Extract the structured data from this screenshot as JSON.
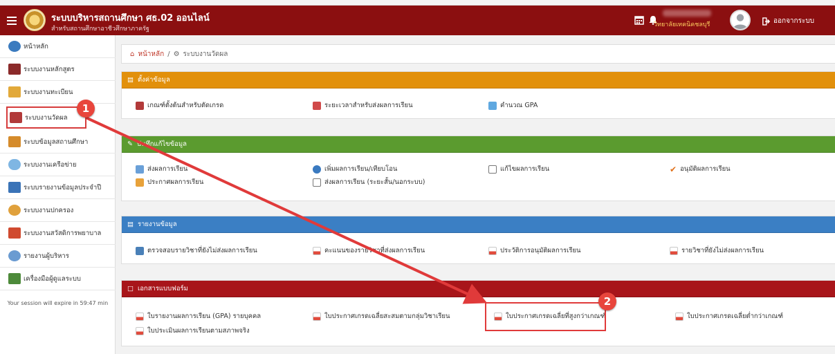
{
  "header": {
    "app_title": "ระบบบริหารสถานศึกษา ศธ.02 ออนไลน์",
    "app_subtitle": "สำหรับสถานศึกษาอาชีวศึกษาภาครัฐ",
    "school": "วิทยาลัยเทคนิคชลบุรี",
    "logout_label": "ออกจากระบบ",
    "icons": [
      "menu-icon",
      "calendar-icon",
      "bell-icon",
      "user-avatar",
      "logout-icon"
    ]
  },
  "sidebar": {
    "items": [
      {
        "label": "หน้าหลัก",
        "icon": "home-icon",
        "color": "#3b7bbf"
      },
      {
        "label": "ระบบงานหลักสูตร",
        "icon": "book-icon",
        "color": "#8b2a2a"
      },
      {
        "label": "ระบบงานทะเบียน",
        "icon": "people-icon",
        "color": "#e2a93a"
      },
      {
        "label": "ระบบงานวัดผล",
        "icon": "calendar-icon",
        "color": "#b23a3a"
      },
      {
        "label": "ระบบข้อมูลสถานศึกษา",
        "icon": "school-icon",
        "color": "#d58b2b"
      },
      {
        "label": "ระบบงานเครือข่าย",
        "icon": "cloud-icon",
        "color": "#7fb6e3"
      },
      {
        "label": "ระบบรายงานข้อมูลประจำปี",
        "icon": "report-icon",
        "color": "#3a73b7"
      },
      {
        "label": "ระบบงานปกครอง",
        "icon": "person-icon",
        "color": "#e0a13c"
      },
      {
        "label": "ระบบงานสวัสดิการพยาบาล",
        "icon": "firstaid-icon",
        "color": "#d04a2f"
      },
      {
        "label": "รายงานผู้บริหาร",
        "icon": "executive-icon",
        "color": "#6a9bd1"
      },
      {
        "label": "เครื่องมือผู้ดูแลระบบ",
        "icon": "admin-icon",
        "color": "#4d8a3a"
      }
    ],
    "session_text": "Your session will expire in 59:47 min"
  },
  "breadcrumb": {
    "home": "หน้าหลัก",
    "separator": "/",
    "current": "ระบบงานวัดผล"
  },
  "panels": [
    {
      "title": "ตั้งค่าข้อมูล",
      "color": "#e2900b",
      "links": [
        "เกณฑ์ตั้งต้นสำหรับตัดเกรด",
        "ระยะเวลาสำหรับส่งผลการเรียน",
        "คำนวณ GPA"
      ]
    },
    {
      "title": "บันทึกแก้ไขข้อมูล",
      "color": "#5b9b2f",
      "links": [
        "ส่งผลการเรียน",
        "เพิ่มผลการเรียน/เทียบโอน",
        "แก้ไขผลการเรียน",
        "อนุมัติผลการเรียน",
        "ประกาศผลการเรียน",
        "ส่งผลการเรียน (ระยะสั้น/นอกระบบ)"
      ]
    },
    {
      "title": "รายงานข้อมูล",
      "color": "#3b7fc4",
      "links": [
        "ตรวจสอบรายวิชาที่ยังไม่ส่งผลการเรียน",
        "คะแนนของรายวิชาที่ส่งผลการเรียน",
        "ประวัติการอนุมัติผลการเรียน",
        "รายวิชาที่ยังไม่ส่งผลการเรียน"
      ]
    },
    {
      "title": "เอกสารแบบฟอร์ม",
      "color": "#a8151a",
      "links": [
        "ใบรายงานผลการเรียน (GPA) รายบุคคล",
        "ใบประกาศเกรดเฉลี่ยสะสมตามกลุ่มวิชาเรียน",
        "ใบประกาศเกรดเฉลี่ยที่สูงกว่าเกณฑ์",
        "ใบประกาศเกรดเฉลี่ยต่ำกว่าเกณฑ์",
        "ใบประเมินผลการเรียนตามสภาพจริง"
      ]
    }
  ],
  "annotations": {
    "badge1": "1",
    "badge2": "2",
    "color": "#e03a3a"
  }
}
